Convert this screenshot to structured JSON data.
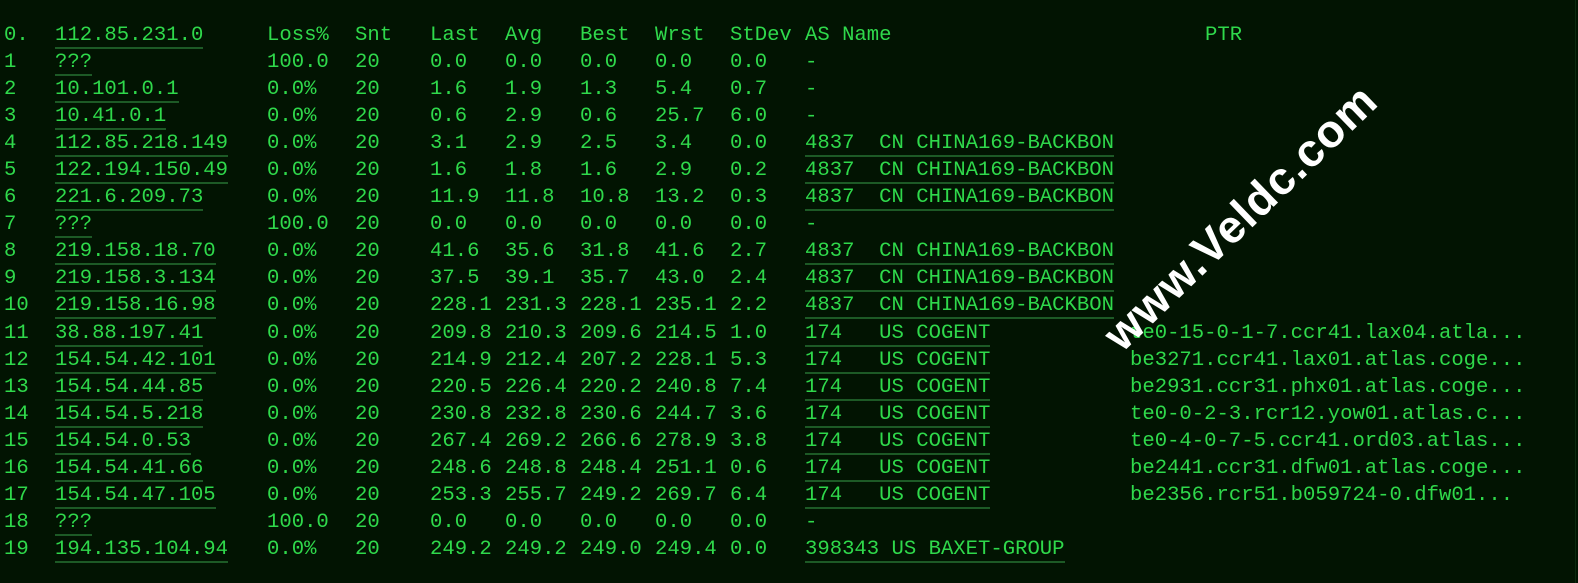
{
  "header": {
    "hop": "0.",
    "host": "112.85.231.0",
    "loss": "Loss%",
    "snt": "Snt",
    "last": "Last",
    "avg": "Avg",
    "best": "Best",
    "wrst": "Wrst",
    "stdev": "StDev",
    "as": "AS Name",
    "ptr": "PTR"
  },
  "rows": [
    {
      "hop": "1",
      "host": "???",
      "loss": "100.0",
      "snt": "20",
      "last": "0.0",
      "avg": "0.0",
      "best": "0.0",
      "wrst": "0.0",
      "stdev": "0.0",
      "as": "-",
      "ptr": ""
    },
    {
      "hop": "2",
      "host": "10.101.0.1",
      "loss": "0.0%",
      "snt": "20",
      "last": "1.6",
      "avg": "1.9",
      "best": "1.3",
      "wrst": "5.4",
      "stdev": "0.7",
      "as": "-",
      "ptr": ""
    },
    {
      "hop": "3",
      "host": "10.41.0.1",
      "loss": "0.0%",
      "snt": "20",
      "last": "0.6",
      "avg": "2.9",
      "best": "0.6",
      "wrst": "25.7",
      "stdev": "6.0",
      "as": "-",
      "ptr": ""
    },
    {
      "hop": "4",
      "host": "112.85.218.149",
      "loss": "0.0%",
      "snt": "20",
      "last": "3.1",
      "avg": "2.9",
      "best": "2.5",
      "wrst": "3.4",
      "stdev": "0.0",
      "as": "4837  CN CHINA169-BACKBON",
      "ptr": ""
    },
    {
      "hop": "5",
      "host": "122.194.150.49",
      "loss": "0.0%",
      "snt": "20",
      "last": "1.6",
      "avg": "1.8",
      "best": "1.6",
      "wrst": "2.9",
      "stdev": "0.2",
      "as": "4837  CN CHINA169-BACKBON",
      "ptr": ""
    },
    {
      "hop": "6",
      "host": "221.6.209.73",
      "loss": "0.0%",
      "snt": "20",
      "last": "11.9",
      "avg": "11.8",
      "best": "10.8",
      "wrst": "13.2",
      "stdev": "0.3",
      "as": "4837  CN CHINA169-BACKBON",
      "ptr": ""
    },
    {
      "hop": "7",
      "host": "???",
      "loss": "100.0",
      "snt": "20",
      "last": "0.0",
      "avg": "0.0",
      "best": "0.0",
      "wrst": "0.0",
      "stdev": "0.0",
      "as": "-",
      "ptr": ""
    },
    {
      "hop": "8",
      "host": "219.158.18.70",
      "loss": "0.0%",
      "snt": "20",
      "last": "41.6",
      "avg": "35.6",
      "best": "31.8",
      "wrst": "41.6",
      "stdev": "2.7",
      "as": "4837  CN CHINA169-BACKBON",
      "ptr": ""
    },
    {
      "hop": "9",
      "host": "219.158.3.134",
      "loss": "0.0%",
      "snt": "20",
      "last": "37.5",
      "avg": "39.1",
      "best": "35.7",
      "wrst": "43.0",
      "stdev": "2.4",
      "as": "4837  CN CHINA169-BACKBON",
      "ptr": ""
    },
    {
      "hop": "10",
      "host": "219.158.16.98",
      "loss": "0.0%",
      "snt": "20",
      "last": "228.1",
      "avg": "231.3",
      "best": "228.1",
      "wrst": "235.1",
      "stdev": "2.2",
      "as": "4837  CN CHINA169-BACKBON",
      "ptr": ""
    },
    {
      "hop": "11",
      "host": "38.88.197.41",
      "loss": "0.0%",
      "snt": "20",
      "last": "209.8",
      "avg": "210.3",
      "best": "209.6",
      "wrst": "214.5",
      "stdev": "1.0",
      "as": "174   US COGENT",
      "ptr": "te0-15-0-1-7.ccr41.lax04.atla..."
    },
    {
      "hop": "12",
      "host": "154.54.42.101",
      "loss": "0.0%",
      "snt": "20",
      "last": "214.9",
      "avg": "212.4",
      "best": "207.2",
      "wrst": "228.1",
      "stdev": "5.3",
      "as": "174   US COGENT",
      "ptr": "be3271.ccr41.lax01.atlas.coge..."
    },
    {
      "hop": "13",
      "host": "154.54.44.85",
      "loss": "0.0%",
      "snt": "20",
      "last": "220.5",
      "avg": "226.4",
      "best": "220.2",
      "wrst": "240.8",
      "stdev": "7.4",
      "as": "174   US COGENT",
      "ptr": "be2931.ccr31.phx01.atlas.coge..."
    },
    {
      "hop": "14",
      "host": "154.54.5.218",
      "loss": "0.0%",
      "snt": "20",
      "last": "230.8",
      "avg": "232.8",
      "best": "230.6",
      "wrst": "244.7",
      "stdev": "3.6",
      "as": "174   US COGENT",
      "ptr": "te0-0-2-3.rcr12.yow01.atlas.c..."
    },
    {
      "hop": "15",
      "host": "154.54.0.53",
      "loss": "0.0%",
      "snt": "20",
      "last": "267.4",
      "avg": "269.2",
      "best": "266.6",
      "wrst": "278.9",
      "stdev": "3.8",
      "as": "174   US COGENT",
      "ptr": "te0-4-0-7-5.ccr41.ord03.atlas..."
    },
    {
      "hop": "16",
      "host": "154.54.41.66",
      "loss": "0.0%",
      "snt": "20",
      "last": "248.6",
      "avg": "248.8",
      "best": "248.4",
      "wrst": "251.1",
      "stdev": "0.6",
      "as": "174   US COGENT",
      "ptr": "be2441.ccr31.dfw01.atlas.coge..."
    },
    {
      "hop": "17",
      "host": "154.54.47.105",
      "loss": "0.0%",
      "snt": "20",
      "last": "253.3",
      "avg": "255.7",
      "best": "249.2",
      "wrst": "269.7",
      "stdev": "6.4",
      "as": "174   US COGENT",
      "ptr": "be2356.rcr51.b059724-0.dfw01..."
    },
    {
      "hop": "18",
      "host": "???",
      "loss": "100.0",
      "snt": "20",
      "last": "0.0",
      "avg": "0.0",
      "best": "0.0",
      "wrst": "0.0",
      "stdev": "0.0",
      "as": "-",
      "ptr": ""
    },
    {
      "hop": "19",
      "host": "194.135.104.94",
      "loss": "0.0%",
      "snt": "20",
      "last": "249.2",
      "avg": "249.2",
      "best": "249.0",
      "wrst": "249.4",
      "stdev": "0.0",
      "as": "398343 US BAXET-GROUP",
      "ptr": ""
    }
  ],
  "watermark": "www.Veldc.com",
  "colors": {
    "background": "#021402",
    "text": "#2fd94b",
    "underline": "#1d5a26"
  }
}
